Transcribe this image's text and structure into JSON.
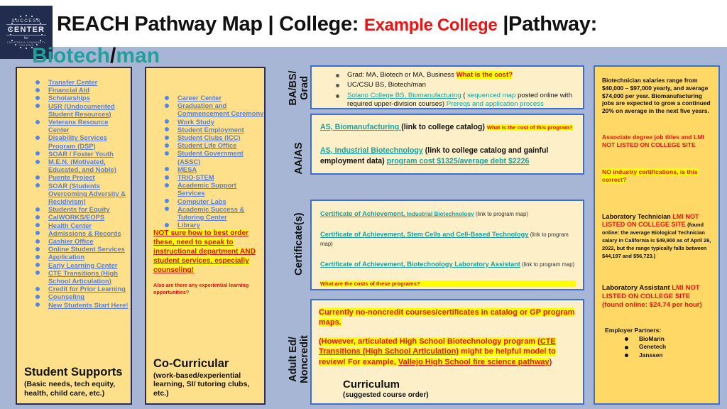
{
  "header": {
    "title_part1": "REACH Pathway Map  ",
    "divider1": "| ",
    "college_label": "College: ",
    "college_name": "Example College",
    "divider2": " |",
    "pathway_label": "Pathway:",
    "pathway_name_1": "Biotech",
    "pathway_slash": "/",
    "pathway_name_2": "man",
    "logo": {
      "line1": "SUCCESS",
      "line2": "CENTER",
      "line3": "for",
      "line4": "CALIFORNIA COMMUNITY",
      "line5": "COLLEGES"
    }
  },
  "student_supports": {
    "items": [
      "Transfer Center",
      "Financial Aid",
      "Scholarships",
      "USR (Undocumented Student Resources)",
      "Veterans Resource Center",
      "Disability Services Program (DSP)",
      "SOAR / Foster Youth",
      "M.E.N. (Motivated, Educated, and Noble)",
      "Puente Project",
      "SOAR (Students Overcoming Adversity & Recidivism)",
      "Students for Equity",
      "CalWORKS/EOPS",
      "Health Center",
      "Admissions & Records",
      "Cashier Office",
      "Online Student Services",
      "Application",
      "Early Learning Center",
      "CTE Transitions (High School Articulation)",
      "Credit for Prior Learning",
      "Counseling",
      "New Students Start Here!"
    ],
    "footer_title": "Student Supports",
    "footer_sub": "(Basic needs, tech equity, health, child care, etc.)"
  },
  "co_curricular": {
    "items": [
      "Career Center",
      "Graduation and Commencement Ceremony",
      "Work Study",
      "Student Employment",
      "Student Clubs (ICC)",
      "Student Life Office",
      "Student Government (ASSC)",
      "MESA",
      "TRIO-STEM",
      "Academic Support Services",
      "Computer Labs",
      "Academic Success & Tutoring Center",
      "Library"
    ],
    "note_highlighted": "NOT sure how to best order these, need to speak to instructional department AND student services, especially counseling!",
    "note_small": "Also are there any experiential learning opportunities?",
    "footer_title": "Co-Curricular",
    "footer_sub": "(work-based/experiential learning, SI/ tutoring clubs, etc.)"
  },
  "row_labels": {
    "ba_bs_grad": "BA/BS/ Grad",
    "aa_as": "AA/AS",
    "certificates": "Certificate(s)",
    "adult_ed": "Adult Ed/ Noncredit"
  },
  "ba_bs_grad": {
    "bullet1_text": "Grad: MA, Biotech or MA, Business",
    "bullet1_note": "What is the cost?",
    "bullet2_text": "UC/CSU BS, Biotech/man",
    "bullet3_link": "Solano College BS, Biomanufacturing",
    "bullet3_open": " ( ",
    "bullet3_link2": "sequenced map",
    "bullet3_mid": " posted online with required upper-division courses) ",
    "bullet3_link3": "Prereqs and application process"
  },
  "aa_as": {
    "line1_link": "AS, Biomanufacturing ",
    "line1_text": " (link to college catalog) ",
    "line1_note": "What is the cost of this program?",
    "line2_link": "AS, Industrial Biotechnology",
    "line2_text": " (link to college catalog and gainful employment data) ",
    "line2_link2": "program cost $1325/average debt $2226"
  },
  "certificates": {
    "items": [
      {
        "link_main": "Certificate of Achievement,",
        "link_sub": " Industrial Biotechnology",
        "note": " (link to program map)"
      },
      {
        "link_main": "Certificate of Achievement, Stem Cells and Cell-Based Technology",
        "link_sub": "",
        "note": " (link to program map)"
      },
      {
        "link_main": "Certificate of Achievement, Biotechnology Laboratory Assistant",
        "link_sub": "",
        "note": " (link to program map)"
      }
    ],
    "question": "What are the costs of these programs?"
  },
  "adult_ed": {
    "para1": "Currently no-noncredit courses/certificates in catalog or GP program maps.",
    "para2_a": "(However, articulated High School Biotechnology program (",
    "para2_link1": "CTE Transitions (High School Articulation)",
    "para2_b": " might be helpful model to review! For example, ",
    "para2_link2": "Vallejo High School fire science pathway",
    "para2_c": ")",
    "footer_title": "Curriculum",
    "footer_sub": "(suggested course order)"
  },
  "labor_market": {
    "salary_paragraph": "Biotechnician salaries range from $40,000 – $97,000 yearly, and average $74,000 per year. Biomanufacturing jobs are expected to grow a continued 20% on average in the next five years.",
    "associate_note": "Associate degree job titles and  LMI NOT LISTED ON COLLEGE SITE",
    "cert_note": "NO industry certifications, is this correct?",
    "job1_title": "Laboratory Technician",
    "job1_flag": "LMI NOT LISTED ON COLLEGE SITE",
    "job1_detail": "(found online: the average Biological Technician salary in California is $49,900 as of April 26, 2022, but the range typically falls between $44,197 and $56,723.)",
    "job2_title": "Laboratory Assistant",
    "job2_flag": "LMI NOT LISTED ON COLLEGE SITE (found online: $24.74 per hour)",
    "employers_heading": "Employer Partners:",
    "employers": [
      "BioMarin",
      "Genetech",
      "Janssen"
    ]
  },
  "colors": {
    "page_background": "#a8b6d6",
    "panel_yellow": "#ffe08a",
    "panel_cream": "#fdf0c8",
    "navy_border": "#2b2b52",
    "blue_border": "#3c6fd1",
    "teal": "#23a09a",
    "red": "#ee1111",
    "highlight_yellow": "#ffff00",
    "link_blue": "#5a7fd4"
  }
}
